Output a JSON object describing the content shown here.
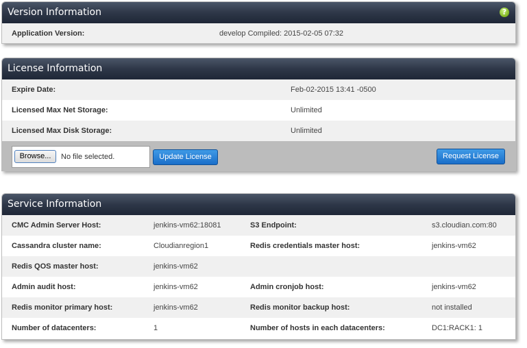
{
  "version": {
    "title": "Version Information",
    "help_icon": "?",
    "app_version_label": "Application Version:",
    "app_version_value": "develop Compiled: 2015-02-05 07:32"
  },
  "license": {
    "title": "License Information",
    "rows": [
      {
        "label": "Expire Date:",
        "value": "Feb-02-2015 13:41 -0500"
      },
      {
        "label": "Licensed Max Net Storage:",
        "value": "Unlimited"
      },
      {
        "label": "Licensed Max Disk Storage:",
        "value": "Unlimited"
      }
    ],
    "browse_label": "Browse...",
    "file_status": "No file selected.",
    "update_label": "Update License",
    "request_label": "Request License"
  },
  "service": {
    "title": "Service Information",
    "rows": [
      {
        "l1": "CMC Admin Server Host:",
        "v1": "jenkins-vm62:18081",
        "l2": "S3 Endpoint:",
        "v2": "s3.cloudian.com:80"
      },
      {
        "l1": "Cassandra cluster name:",
        "v1": "Cloudianregion1",
        "l2": "Redis credentials master host:",
        "v2": "jenkins-vm62"
      },
      {
        "l1": "Redis QOS master host:",
        "v1": "jenkins-vm62",
        "l2": "",
        "v2": ""
      },
      {
        "l1": "Admin audit host:",
        "v1": "jenkins-vm62",
        "l2": "Admin cronjob host:",
        "v2": "jenkins-vm62"
      },
      {
        "l1": "Redis monitor primary host:",
        "v1": "jenkins-vm62",
        "l2": "Redis monitor backup host:",
        "v2": "not installed"
      },
      {
        "l1": "Number of datacenters:",
        "v1": "1",
        "l2": "Number of hosts in each datacenters:",
        "v2": "DC1:RACK1: 1"
      }
    ]
  }
}
